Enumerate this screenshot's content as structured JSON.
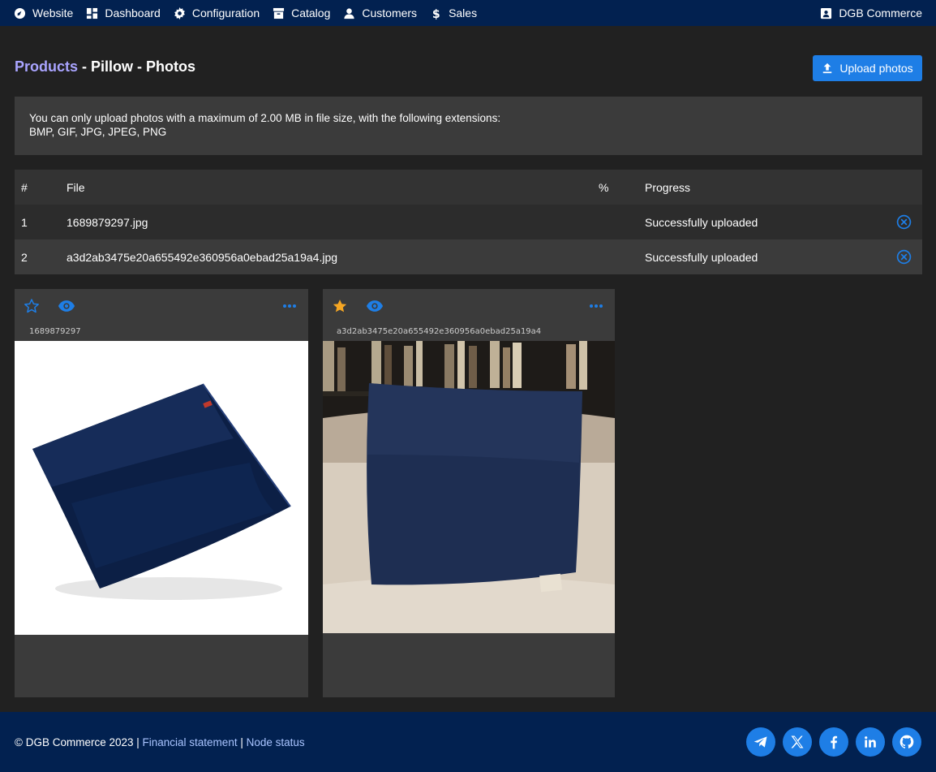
{
  "nav": {
    "items": [
      {
        "label": "Website",
        "icon": "globe-icon"
      },
      {
        "label": "Dashboard",
        "icon": "dashboard-icon"
      },
      {
        "label": "Configuration",
        "icon": "gear-icon"
      },
      {
        "label": "Catalog",
        "icon": "archive-icon"
      },
      {
        "label": "Customers",
        "icon": "user-icon"
      },
      {
        "label": "Sales",
        "icon": "dollar-icon"
      }
    ],
    "account": {
      "label": "DGB Commerce",
      "icon": "contact-card-icon"
    }
  },
  "header": {
    "crumb_products": "Products",
    "sep1": " - ",
    "crumb_product": "Pillow",
    "sep2": " - ",
    "crumb_photos": "Photos",
    "upload_label": "Upload photos"
  },
  "info": {
    "line1": "You can only upload photos with a maximum of 2.00 MB in file size, with the following extensions:",
    "line2": "BMP, GIF, JPG, JPEG, PNG"
  },
  "table": {
    "headers": {
      "num": "#",
      "file": "File",
      "pct": "%",
      "progress": "Progress"
    },
    "rows": [
      {
        "num": "1",
        "file": "1689879297.jpg",
        "pct": "",
        "progress": "Successfully uploaded"
      },
      {
        "num": "2",
        "file": "a3d2ab3475e20a655492e360956a0ebad25a19a4.jpg",
        "pct": "",
        "progress": "Successfully uploaded"
      }
    ]
  },
  "photos": [
    {
      "name": "1689879297",
      "main": false
    },
    {
      "name": "a3d2ab3475e20a655492e360956a0ebad25a19a4",
      "main": true
    }
  ],
  "footer": {
    "copyright": "© DGB Commerce 2023",
    "sep": " | ",
    "financial": "Financial statement",
    "node": "Node status",
    "socials": [
      "telegram-icon",
      "x-icon",
      "facebook-icon",
      "linkedin-icon",
      "github-icon"
    ]
  },
  "colors": {
    "nav_bg": "#022150",
    "accent": "#1e7ee6",
    "crumb_link": "#a9a4ff",
    "star_active": "#f5a623",
    "page_bg": "#212121",
    "panel_bg": "#3b3b3b"
  }
}
